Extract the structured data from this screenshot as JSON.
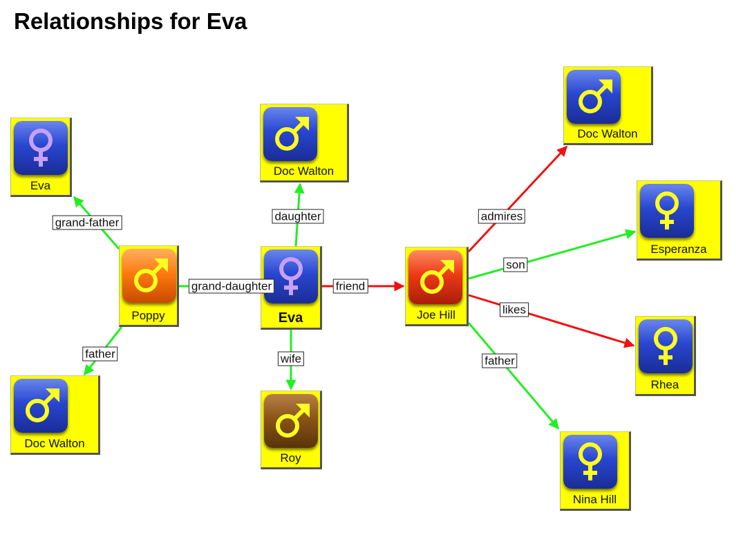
{
  "title": "Relationships for Eva",
  "colors": {
    "node_bg": "#ffff00",
    "edge_green": "#22ee22",
    "edge_red": "#ee1111",
    "icon_blue": "#2244cc",
    "icon_orange": "#ff7a10",
    "icon_red": "#ee3a18",
    "icon_brown": "#8a5418",
    "symbol_yellow": "#ffff22",
    "symbol_lilac": "#c8a0ff"
  },
  "nodes": [
    {
      "id": "eva_center",
      "name": "Eva",
      "gender": "female",
      "icon_color": "blue",
      "symbol_color": "lilac",
      "center": true
    },
    {
      "id": "poppy",
      "name": "Poppy",
      "gender": "male",
      "icon_color": "orange",
      "symbol_color": "yellow"
    },
    {
      "id": "eva_left",
      "name": "Eva",
      "gender": "female",
      "icon_color": "blue",
      "symbol_color": "lilac"
    },
    {
      "id": "doc_walton_bl",
      "name": "Doc Walton",
      "gender": "male",
      "icon_color": "blue",
      "symbol_color": "yellow"
    },
    {
      "id": "doc_walton_top",
      "name": "Doc Walton",
      "gender": "male",
      "icon_color": "blue",
      "symbol_color": "yellow"
    },
    {
      "id": "roy",
      "name": "Roy",
      "gender": "male",
      "icon_color": "brown",
      "symbol_color": "yellow"
    },
    {
      "id": "joe_hill",
      "name": "Joe Hill",
      "gender": "male",
      "icon_color": "red",
      "symbol_color": "yellow"
    },
    {
      "id": "doc_walton_tr",
      "name": "Doc Walton",
      "gender": "male",
      "icon_color": "blue",
      "symbol_color": "yellow"
    },
    {
      "id": "esperanza",
      "name": "Esperanza",
      "gender": "female",
      "icon_color": "blue",
      "symbol_color": "yellow"
    },
    {
      "id": "rhea",
      "name": "Rhea",
      "gender": "female",
      "icon_color": "blue",
      "symbol_color": "yellow"
    },
    {
      "id": "nina_hill",
      "name": "Nina Hill",
      "gender": "female",
      "icon_color": "blue",
      "symbol_color": "yellow"
    }
  ],
  "edges": [
    {
      "from": "poppy",
      "to": "eva_left",
      "label": "grand-father",
      "color": "green"
    },
    {
      "from": "poppy",
      "to": "doc_walton_bl",
      "label": "father",
      "color": "green"
    },
    {
      "from": "eva_center",
      "to": "poppy",
      "label": "grand-daughter",
      "color": "green"
    },
    {
      "from": "eva_center",
      "to": "doc_walton_top",
      "label": "daughter",
      "color": "green"
    },
    {
      "from": "eva_center",
      "to": "roy",
      "label": "wife",
      "color": "green"
    },
    {
      "from": "eva_center",
      "to": "joe_hill",
      "label": "friend",
      "color": "red"
    },
    {
      "from": "joe_hill",
      "to": "doc_walton_tr",
      "label": "admires",
      "color": "red"
    },
    {
      "from": "joe_hill",
      "to": "esperanza",
      "label": "son",
      "color": "green"
    },
    {
      "from": "joe_hill",
      "to": "rhea",
      "label": "likes",
      "color": "red"
    },
    {
      "from": "joe_hill",
      "to": "nina_hill",
      "label": "father",
      "color": "green"
    }
  ]
}
